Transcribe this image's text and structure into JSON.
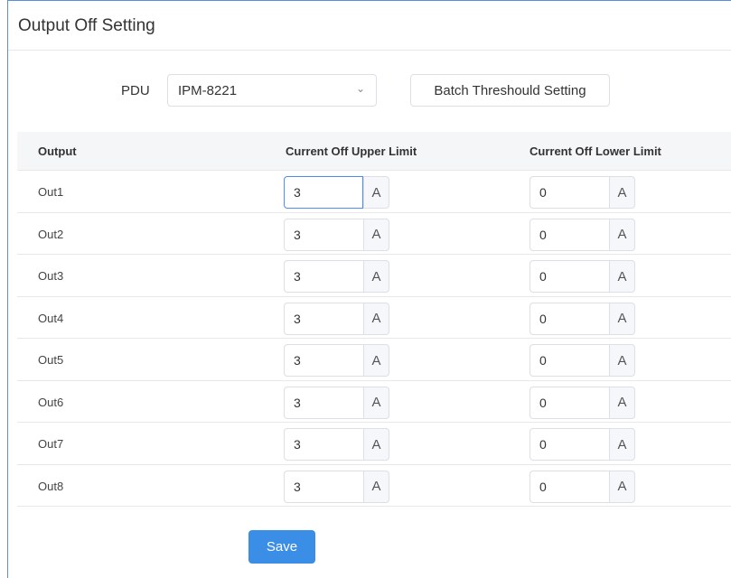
{
  "page": {
    "title": "Output Off Setting"
  },
  "controls": {
    "pdu_label": "PDU",
    "pdu_selected": "IPM-8221",
    "batch_label": "Batch Threshould Setting"
  },
  "table": {
    "headers": {
      "output": "Output",
      "upper": "Current Off Upper Limit",
      "lower": "Current Off Lower Limit"
    },
    "unit": "A",
    "rows": [
      {
        "name": "Out1",
        "upper": "3",
        "lower": "0"
      },
      {
        "name": "Out2",
        "upper": "3",
        "lower": "0"
      },
      {
        "name": "Out3",
        "upper": "3",
        "lower": "0"
      },
      {
        "name": "Out4",
        "upper": "3",
        "lower": "0"
      },
      {
        "name": "Out5",
        "upper": "3",
        "lower": "0"
      },
      {
        "name": "Out6",
        "upper": "3",
        "lower": "0"
      },
      {
        "name": "Out7",
        "upper": "3",
        "lower": "0"
      },
      {
        "name": "Out8",
        "upper": "3",
        "lower": "0"
      }
    ]
  },
  "actions": {
    "save_label": "Save"
  },
  "colors": {
    "accent": "#3a8ee6",
    "border": "#dcdfe6",
    "header_bg": "#f5f6f8",
    "frame": "#5b8fd6"
  }
}
